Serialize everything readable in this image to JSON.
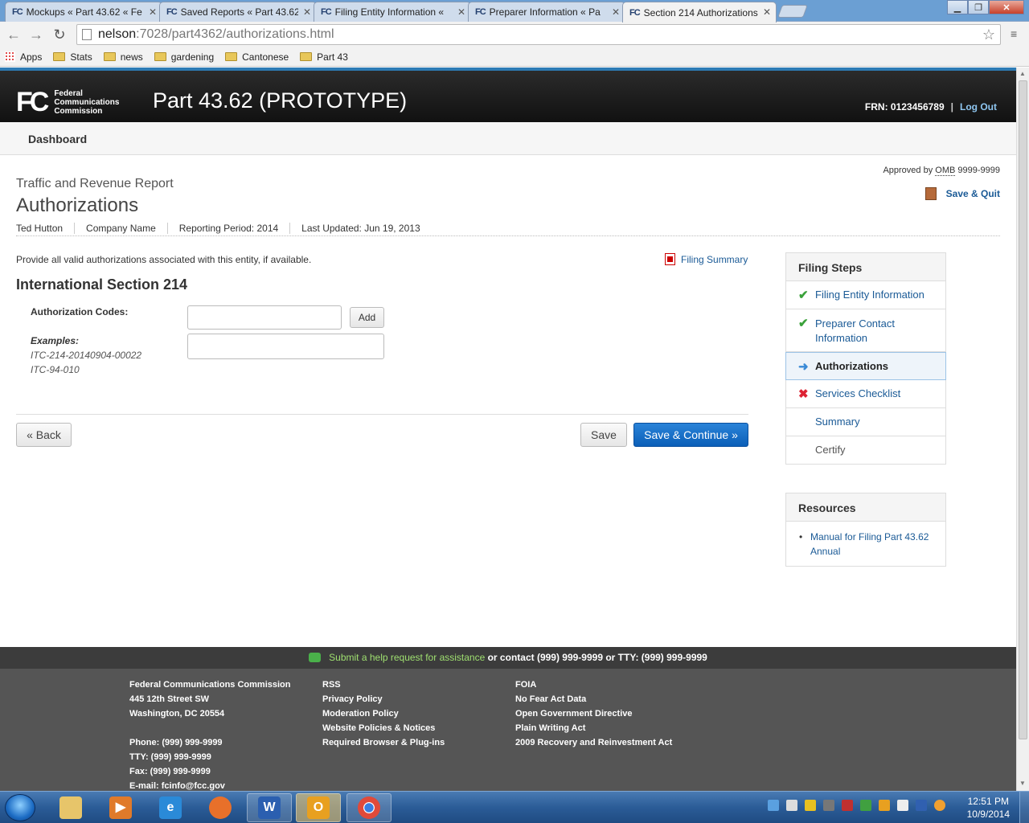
{
  "browser": {
    "tabs": [
      {
        "title": "Mockups « Part 43.62 « Fe",
        "icon": "fcc-icon"
      },
      {
        "title": "Saved Reports « Part 43.62",
        "icon": "fcc-icon"
      },
      {
        "title": "Filing Entity Information «",
        "icon": "fcc-icon"
      },
      {
        "title": "Preparer Information « Pa",
        "icon": "fcc-icon"
      },
      {
        "title": "Section 214 Authorizations",
        "icon": "fcc-icon",
        "active": true
      }
    ],
    "fcc_icon_text": "FC",
    "url_host": "nelson",
    "url_path": ":7028/part4362/authorizations.html",
    "bookmarks": [
      "Apps",
      "Stats",
      "news",
      "gardening",
      "Cantonese",
      "Part 43"
    ]
  },
  "header": {
    "logo_mark": "FC",
    "logo_line1": "Federal",
    "logo_line2": "Communications",
    "logo_line3": "Commission",
    "app_title": "Part 43.62 (PROTOTYPE)",
    "frn": "FRN: 0123456789",
    "separator": "|",
    "logout": "Log Out"
  },
  "subnav": {
    "dashboard": "Dashboard"
  },
  "page": {
    "omb_prefix": "Approved by",
    "omb_abbr": "OMB",
    "omb_number": "9999-9999",
    "save_quit": "Save & Quit",
    "report_name": "Traffic and Revenue Report",
    "title": "Authorizations",
    "meta": {
      "user": "Ted Hutton",
      "company": "Company Name",
      "period": "Reporting Period: 2014",
      "updated": "Last Updated: Jun 19, 2013"
    },
    "intro": "Provide all valid authorizations associated with this entity, if available.",
    "filing_summary": "Filing Summary",
    "section_heading": "International Section 214",
    "auth_label": "Authorization Codes:",
    "add_label": "Add",
    "examples_label": "Examples:",
    "example_1": "ITC-214-20140904-00022",
    "example_2": "ITC-94-010",
    "back_label": "« Back",
    "save_label": "Save",
    "save_continue_label": "Save & Continue »"
  },
  "filing_steps": {
    "heading": "Filing Steps",
    "steps": [
      {
        "label": "Filing Entity Information",
        "status": "complete",
        "icon": "check-icon"
      },
      {
        "label": "Preparer Contact Information",
        "status": "complete",
        "icon": "check-icon"
      },
      {
        "label": "Authorizations",
        "status": "current",
        "icon": "arrow-right-icon"
      },
      {
        "label": "Services Checklist",
        "status": "incomplete",
        "icon": "cross-icon"
      },
      {
        "label": "Summary",
        "status": "pending"
      },
      {
        "label": "Certify",
        "status": "disabled"
      }
    ]
  },
  "resources": {
    "heading": "Resources",
    "items": [
      "Manual for Filing Part 43.62 Annual"
    ]
  },
  "helpbar": {
    "link": "Submit a help request for assistance",
    "rest": " or contact (999) 999-9999 or TTY: (999) 999-9999"
  },
  "footer": {
    "col1": [
      "Federal Communications Commission",
      "445 12th Street SW",
      "Washington, DC 20554",
      "",
      "Phone: (999) 999-9999",
      "TTY: (999) 999-9999",
      "Fax: (999) 999-9999",
      "E-mail: fcinfo@fcc.gov"
    ],
    "col2": [
      "RSS",
      "Privacy Policy",
      "Moderation Policy",
      "Website Policies & Notices",
      "Required Browser & Plug-ins"
    ],
    "col3": [
      "FOIA",
      "No Fear Act Data",
      "Open Government Directive",
      "Plain Writing Act",
      "2009 Recovery and Reinvestment Act"
    ]
  },
  "taskbar": {
    "time": "12:51 PM",
    "date": "10/9/2014",
    "apps": [
      "explorer-icon",
      "media-player-icon",
      "internet-explorer-icon",
      "firefox-icon",
      "word-icon",
      "outlook-icon",
      "chrome-icon"
    ]
  },
  "colors": {
    "accent": "#2d7bb4",
    "link": "#1a5a96",
    "primary_button": "#0b5fb8",
    "check": "#3aa13a",
    "cross": "#dd2233"
  }
}
